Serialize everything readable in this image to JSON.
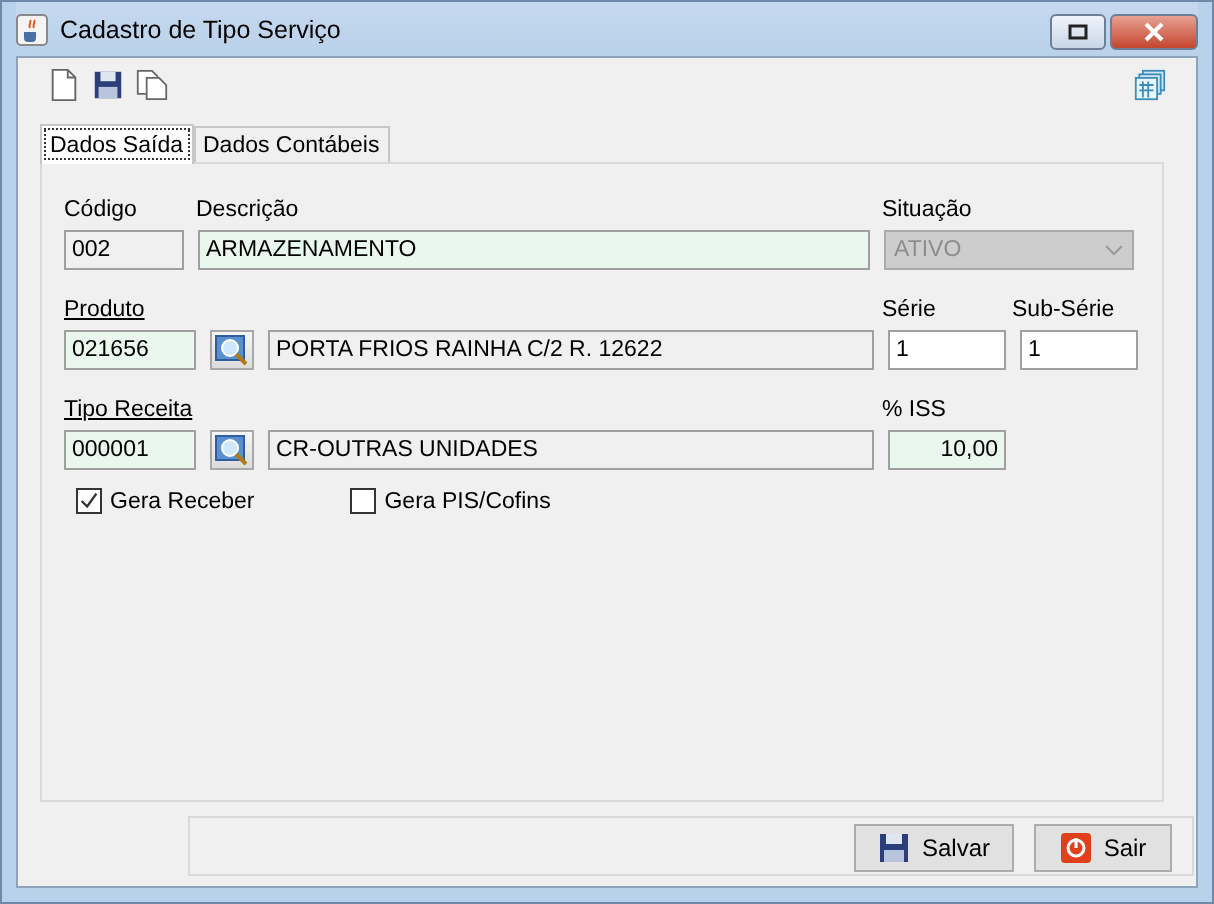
{
  "window": {
    "title": "Cadastro de Tipo Serviço"
  },
  "tabs": [
    {
      "label": "Dados Saída",
      "selected": true
    },
    {
      "label": "Dados Contábeis",
      "selected": false
    }
  ],
  "codigo": {
    "label": "Código",
    "value": "002",
    "kind": "readonly"
  },
  "descricao": {
    "label": "Descrição",
    "value": "ARMAZENAMENTO",
    "kind": "required"
  },
  "situacao": {
    "label": "Situação",
    "value": "ATIVO",
    "disabled": true
  },
  "produto": {
    "label": "Produto",
    "code": {
      "value": "021656",
      "kind": "required"
    },
    "description": {
      "value": "PORTA FRIOS RAINHA C/2 R. 12622",
      "kind": "readonly"
    }
  },
  "serie": {
    "label": "Série",
    "value": "1",
    "kind": "plain"
  },
  "sub_serie": {
    "label": "Sub-Série",
    "value": "1",
    "kind": "plain"
  },
  "tipo_receita": {
    "label": "Tipo Receita",
    "code": {
      "value": "000001",
      "kind": "required"
    },
    "description": {
      "value": "CR-OUTRAS UNIDADES",
      "kind": "readonly"
    }
  },
  "iss": {
    "label": "% ISS",
    "value": "10,00",
    "kind": "required"
  },
  "checkboxes": [
    {
      "label": "Gera Receber",
      "checked": true
    },
    {
      "label": "Gera PIS/Cofins",
      "checked": false
    }
  ],
  "buttons": [
    {
      "label": "Salvar",
      "kind": "save"
    },
    {
      "label": "Sair",
      "kind": "exit"
    }
  ]
}
